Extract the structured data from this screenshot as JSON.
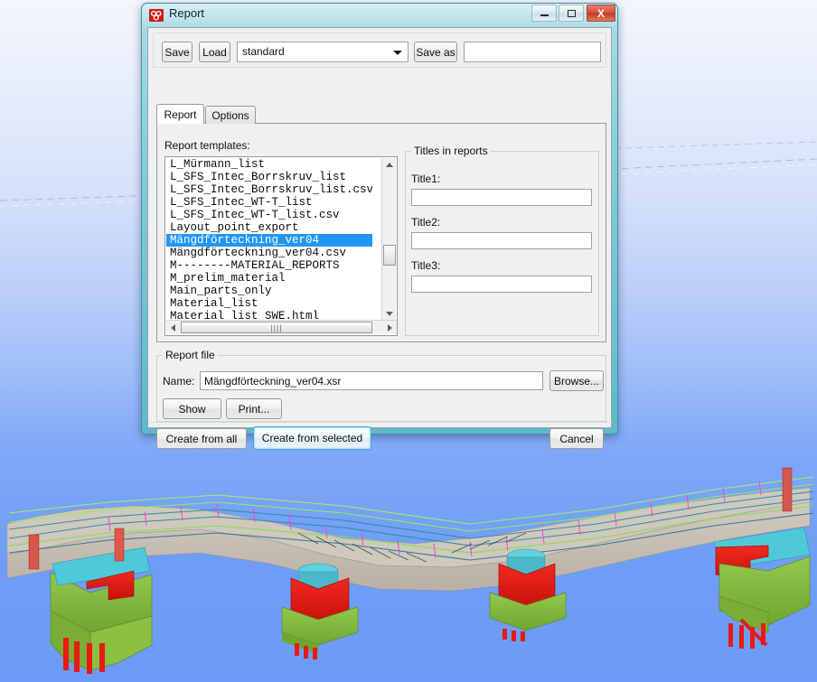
{
  "window": {
    "title": "Report",
    "icon": "tekla-report-icon",
    "controls": {
      "minimize": "minimize-icon",
      "maximize": "maximize-icon",
      "close": "X"
    }
  },
  "toolbar": {
    "save_label": "Save",
    "load_label": "Load",
    "attribute_combo_value": "standard",
    "attribute_combo_arrow": "chevron-down-icon",
    "save_as_label": "Save as",
    "save_as_value": "",
    "save_as_placeholder": ""
  },
  "tabs": [
    {
      "label": "Report",
      "active": true
    },
    {
      "label": "Options",
      "active": false
    }
  ],
  "report_tab": {
    "templates_label": "Report templates:",
    "templates": [
      {
        "name": "L_Mürmann_list",
        "selected": false
      },
      {
        "name": "L_SFS_Intec_Borrskruv_list",
        "selected": false
      },
      {
        "name": "L_SFS_Intec_Borrskruv_list.csv",
        "selected": false
      },
      {
        "name": "L_SFS_Intec_WT-T_list",
        "selected": false
      },
      {
        "name": "L_SFS_Intec_WT-T_list.csv",
        "selected": false
      },
      {
        "name": "Layout_point_export",
        "selected": false
      },
      {
        "name": "Mängdförteckning_ver04",
        "selected": true
      },
      {
        "name": "Mängdförteckning_ver04.csv",
        "selected": false
      },
      {
        "name": "M--------MATERIAL_REPORTS",
        "selected": false
      },
      {
        "name": "M_prelim_material",
        "selected": false
      },
      {
        "name": "Main_parts_only",
        "selected": false
      },
      {
        "name": "Material_list",
        "selected": false
      },
      {
        "name": "Material_list_SWE.html",
        "selected": false
      }
    ],
    "scroll_grip": "||||",
    "titles_group_label": "Titles in reports",
    "titles": [
      {
        "label": "Title1:",
        "value": ""
      },
      {
        "label": "Title2:",
        "value": ""
      },
      {
        "label": "Title3:",
        "value": ""
      }
    ]
  },
  "report_file": {
    "group_label": "Report file",
    "name_label": "Name:",
    "name_value": "Mängdförteckning_ver04.xsr",
    "browse_label": "Browse...",
    "show_label": "Show",
    "print_label": "Print..."
  },
  "actions": {
    "create_from_all": "Create from all",
    "create_from_selected": "Create from selected",
    "cancel": "Cancel"
  },
  "colors": {
    "selection_blue": "#2196f3",
    "dialog_frame_teal": "#5fb8c9",
    "default_button_highlight": "#3ea8d8",
    "close_button_red": "#bf3a24",
    "viewport_sky_top": "#f2f6fd",
    "viewport_sky_bottom": "#6b9bf6"
  },
  "model_view": {
    "description": "3D bridge structure model",
    "element_colors": {
      "deck_concrete": "#c7bfb4",
      "bearing_cyan": "#54c9d8",
      "pier_red": "#e01b14",
      "footing_green": "#7fba3c",
      "rebar_green_line": "#7ef442",
      "rebar_teal_line": "#2e8b9b"
    }
  }
}
